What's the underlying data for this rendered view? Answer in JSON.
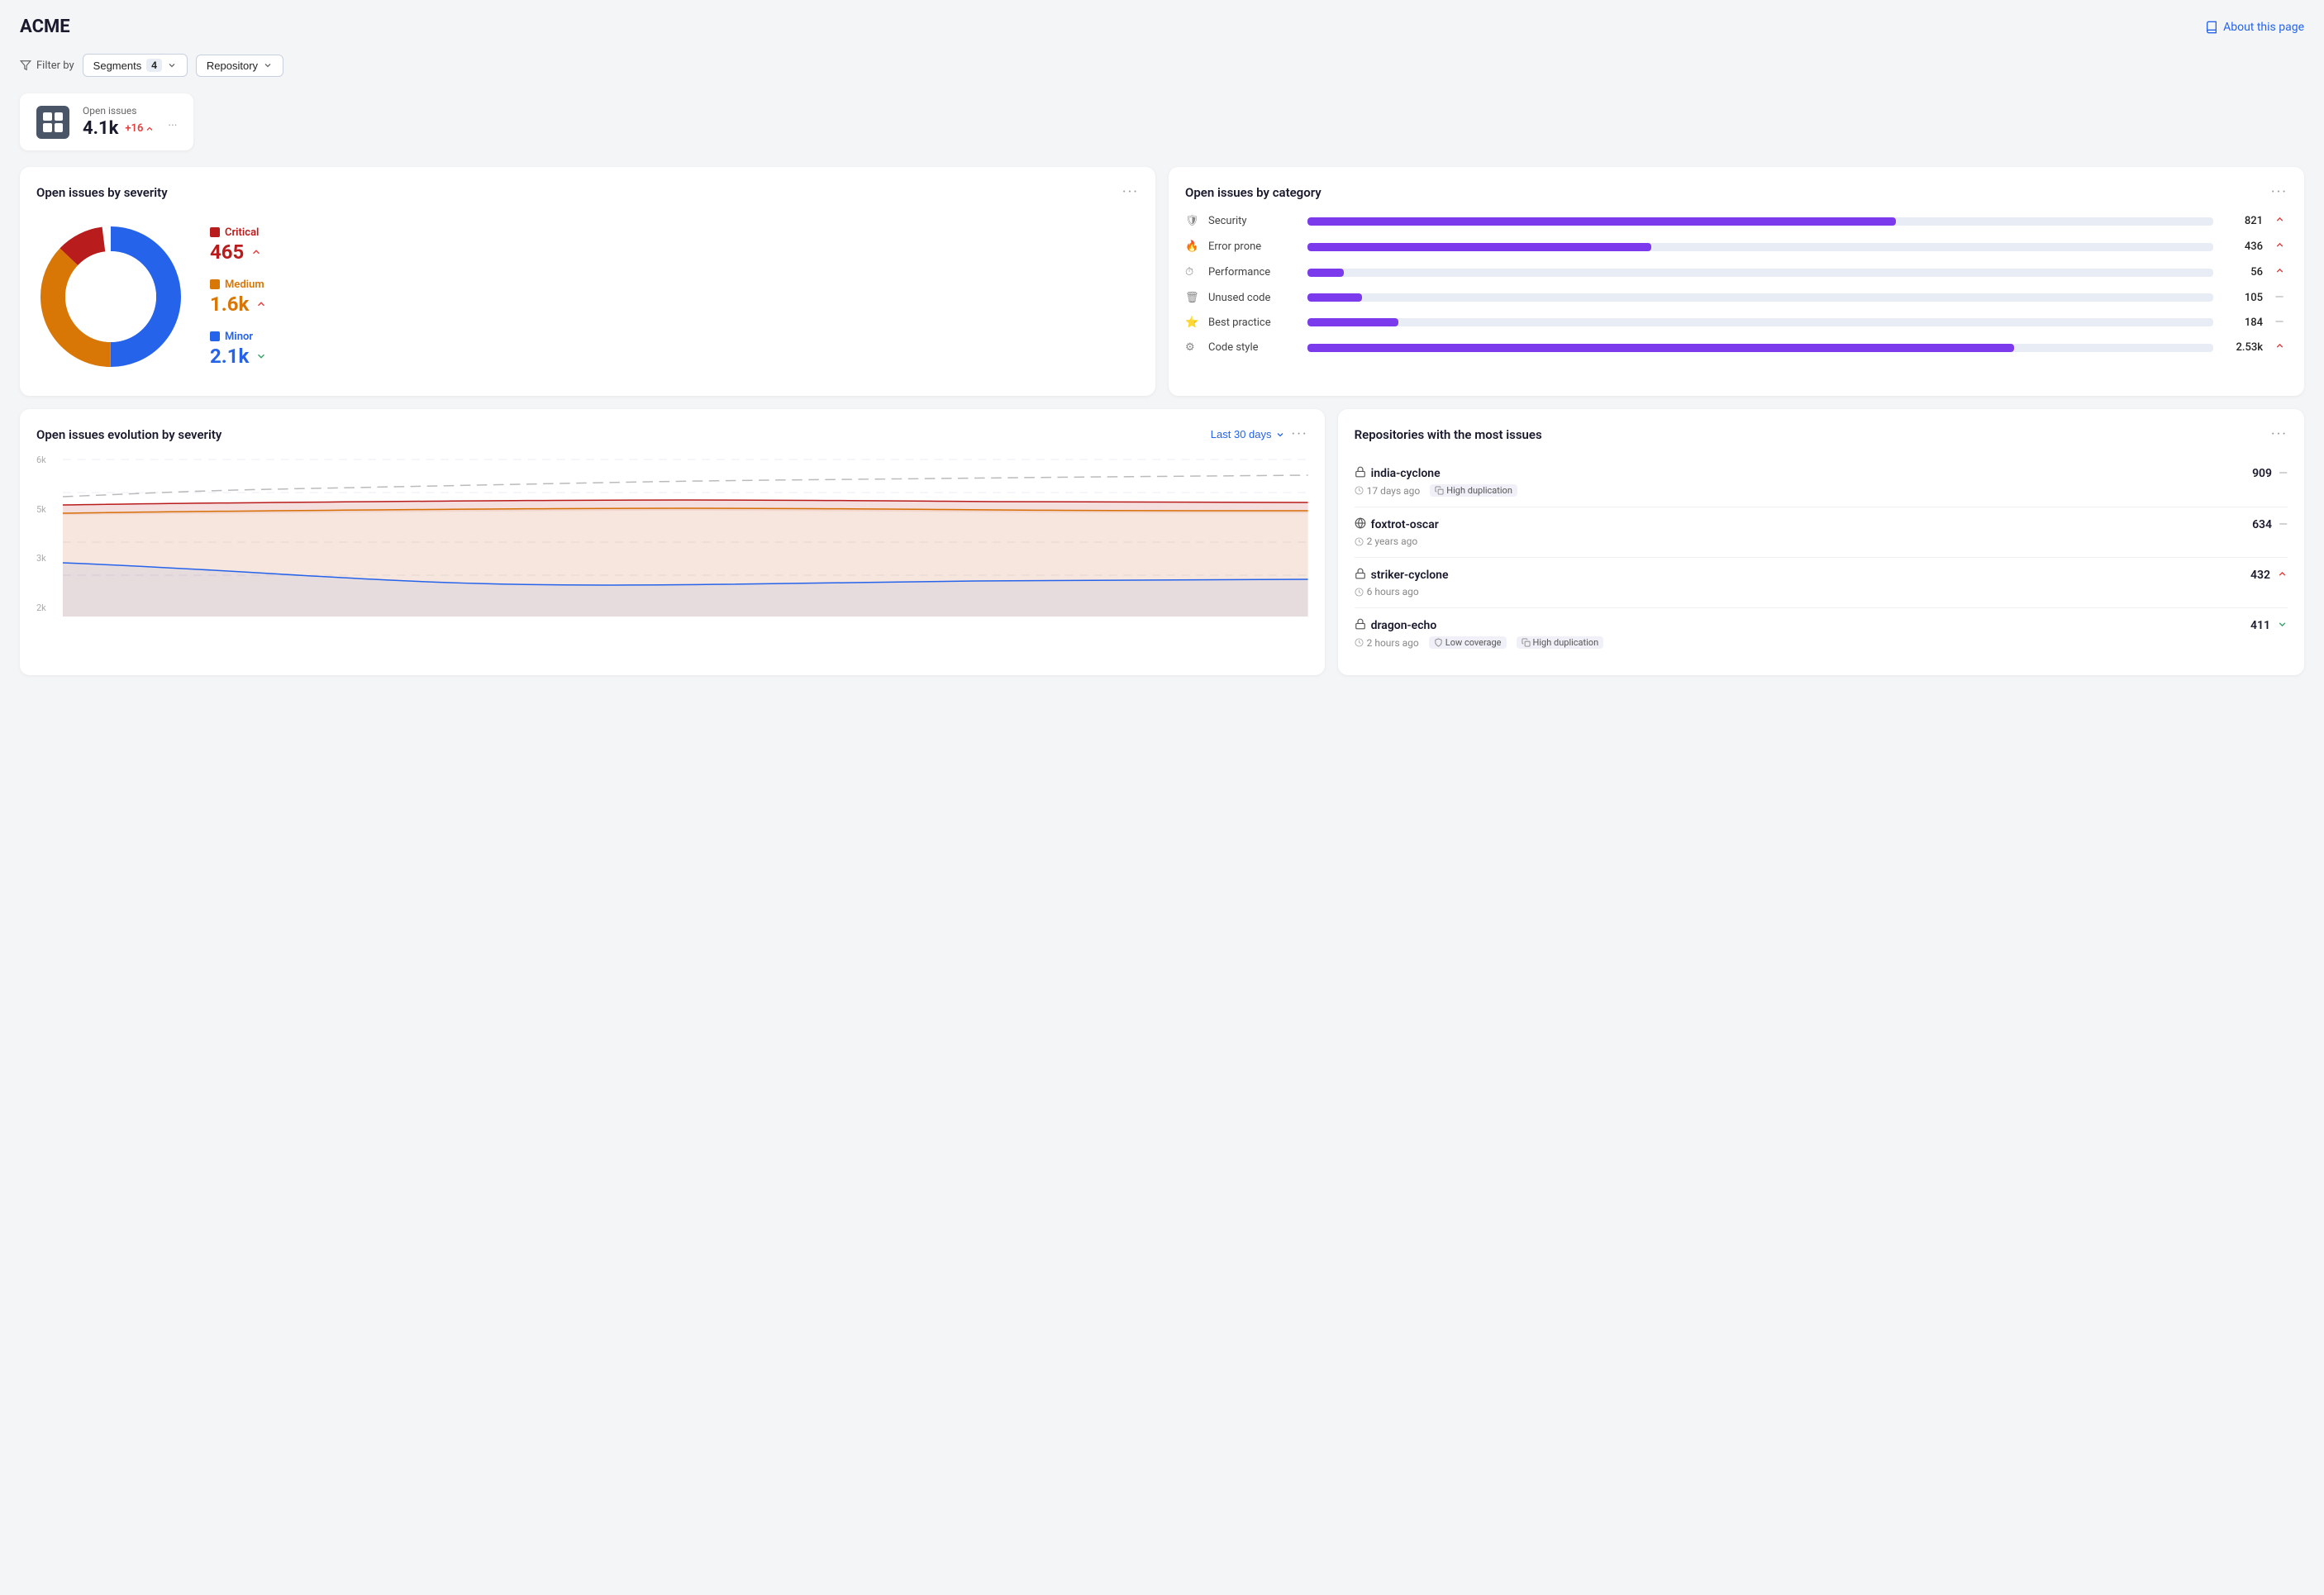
{
  "app": {
    "title": "ACME",
    "about_label": "About this page"
  },
  "filter": {
    "label": "Filter by",
    "segments_label": "Segments",
    "segments_count": "4",
    "repository_label": "Repository"
  },
  "summary_card": {
    "label": "Open issues",
    "value": "4.1k",
    "delta": "+16",
    "more": "..."
  },
  "severity_chart": {
    "title": "Open issues by severity",
    "legend": [
      {
        "key": "critical",
        "label": "Critical",
        "value": "465",
        "delta": "up",
        "color": "#b91c1c"
      },
      {
        "key": "medium",
        "label": "Medium",
        "value": "1.6k",
        "delta": "up",
        "color": "#d97706"
      },
      {
        "key": "minor",
        "label": "Minor",
        "value": "2.1k",
        "delta": "down",
        "color": "#2563eb"
      }
    ],
    "donut": {
      "critical_pct": 11,
      "medium_pct": 37,
      "minor_pct": 50,
      "critical_color": "#b91c1c",
      "medium_color": "#d97706",
      "minor_color": "#2563eb"
    }
  },
  "category_chart": {
    "title": "Open issues by category",
    "categories": [
      {
        "name": "Security",
        "icon": "shield",
        "count": "821",
        "pct": 65,
        "trend": "up"
      },
      {
        "name": "Error prone",
        "icon": "flame",
        "count": "436",
        "pct": 38,
        "trend": "up"
      },
      {
        "name": "Performance",
        "icon": "clock",
        "count": "56",
        "pct": 4,
        "trend": "up"
      },
      {
        "name": "Unused code",
        "icon": "trash",
        "count": "105",
        "pct": 6,
        "trend": "neutral"
      },
      {
        "name": "Best practice",
        "icon": "star",
        "count": "184",
        "pct": 10,
        "trend": "neutral"
      },
      {
        "name": "Code style",
        "icon": "code",
        "count": "2.53k",
        "pct": 78,
        "trend": "up"
      }
    ]
  },
  "evolution_chart": {
    "title": "Open issues evolution by severity",
    "period_label": "Last 30 days",
    "y_labels": [
      "6k",
      "5k",
      "3k",
      "2k"
    ],
    "lines": [
      {
        "key": "total",
        "color": "#aaa",
        "dash": true
      },
      {
        "key": "critical",
        "color": "#b91c1c"
      },
      {
        "key": "medium",
        "color": "#d97706"
      },
      {
        "key": "minor",
        "color": "#2563eb"
      }
    ]
  },
  "repos_card": {
    "title": "Repositories with the most issues",
    "repos": [
      {
        "name": "india-cyclone",
        "icon": "lock",
        "count": "909",
        "trend": "neutral",
        "time": "17 days ago",
        "tags": [
          "High duplication"
        ]
      },
      {
        "name": "foxtrot-oscar",
        "icon": "globe",
        "count": "634",
        "trend": "neutral",
        "time": "2 years ago",
        "tags": []
      },
      {
        "name": "striker-cyclone",
        "icon": "lock",
        "count": "432",
        "trend": "up",
        "time": "6 hours ago",
        "tags": []
      },
      {
        "name": "dragon-echo",
        "icon": "lock",
        "count": "411",
        "trend": "down",
        "time": "2 hours ago",
        "tags": [
          "Low coverage",
          "High duplication"
        ]
      }
    ]
  }
}
